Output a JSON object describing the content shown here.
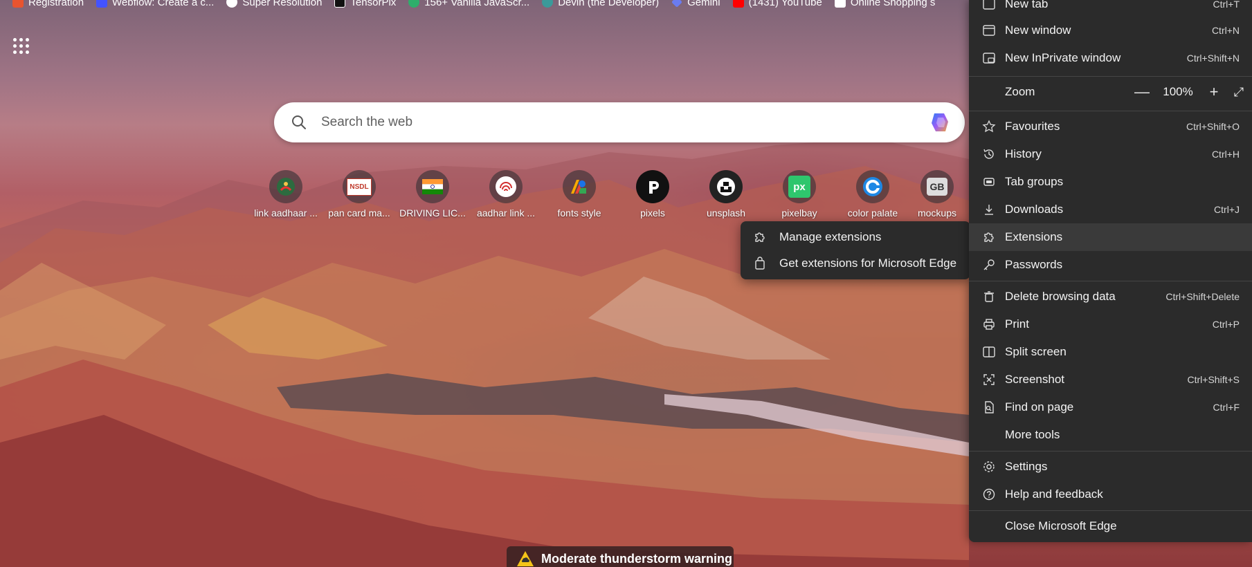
{
  "favorites": [
    {
      "label": "Registration",
      "color": "#e8542f"
    },
    {
      "label": "Webflow: Create a c...",
      "color": "#4353ff"
    },
    {
      "label": "Super Resolution",
      "color": "#ffffff"
    },
    {
      "label": "TensorPix",
      "color": "#111111"
    },
    {
      "label": "156+ Vanilla JavaScr...",
      "color": "#2eae6b"
    },
    {
      "label": "Devin (the Developer)",
      "color": "#3a9a9a"
    },
    {
      "label": "Gemini",
      "color": "#6a7cf0"
    },
    {
      "label": "(1431) YouTube",
      "color": "#ff0000"
    },
    {
      "label": "Online Shopping s",
      "color": "#ffffff"
    }
  ],
  "search": {
    "placeholder": "Search the web"
  },
  "quick_links": [
    {
      "label": "link aadhaar ...",
      "icon": "aadhaar-icon"
    },
    {
      "label": "pan card ma...",
      "icon": "nsdl-icon",
      "text": "NSDL"
    },
    {
      "label": "DRIVING LIC...",
      "icon": "india-flag-icon"
    },
    {
      "label": "aadhar link ...",
      "icon": "fingerprint-icon"
    },
    {
      "label": "fonts style",
      "icon": "google-fonts-icon"
    },
    {
      "label": "pixels",
      "icon": "pexels-icon"
    },
    {
      "label": "unsplash",
      "icon": "unsplash-icon"
    },
    {
      "label": "pixelbay",
      "icon": "pixabay-icon",
      "text": "px"
    },
    {
      "label": "color palate",
      "icon": "color-palette-icon"
    },
    {
      "label": "mockups",
      "icon": "gb-icon",
      "text": "GB"
    }
  ],
  "submenu": {
    "items": [
      {
        "label": "Manage extensions",
        "icon": "puzzle-icon"
      },
      {
        "label": "Get extensions for Microsoft Edge",
        "icon": "shopping-bag-icon"
      }
    ]
  },
  "menu": {
    "new_tab": {
      "label": "New tab",
      "shortcut": "Ctrl+T"
    },
    "new_window": {
      "label": "New window",
      "shortcut": "Ctrl+N"
    },
    "new_inprivate": {
      "label": "New InPrivate window",
      "shortcut": "Ctrl+Shift+N"
    },
    "zoom": {
      "label": "Zoom",
      "value": "100%",
      "minus": "—",
      "plus": "+"
    },
    "favourites": {
      "label": "Favourites",
      "shortcut": "Ctrl+Shift+O"
    },
    "history": {
      "label": "History",
      "shortcut": "Ctrl+H"
    },
    "tab_groups": {
      "label": "Tab groups"
    },
    "downloads": {
      "label": "Downloads",
      "shortcut": "Ctrl+J"
    },
    "extensions": {
      "label": "Extensions"
    },
    "passwords": {
      "label": "Passwords"
    },
    "delete_data": {
      "label": "Delete browsing data",
      "shortcut": "Ctrl+Shift+Delete"
    },
    "print": {
      "label": "Print",
      "shortcut": "Ctrl+P"
    },
    "split_screen": {
      "label": "Split screen"
    },
    "screenshot": {
      "label": "Screenshot",
      "shortcut": "Ctrl+Shift+S"
    },
    "find": {
      "label": "Find on page",
      "shortcut": "Ctrl+F"
    },
    "more_tools": {
      "label": "More tools"
    },
    "settings": {
      "label": "Settings"
    },
    "help": {
      "label": "Help and feedback"
    },
    "close": {
      "label": "Close Microsoft Edge"
    }
  },
  "weather": {
    "label": "Moderate thunderstorm warning"
  }
}
